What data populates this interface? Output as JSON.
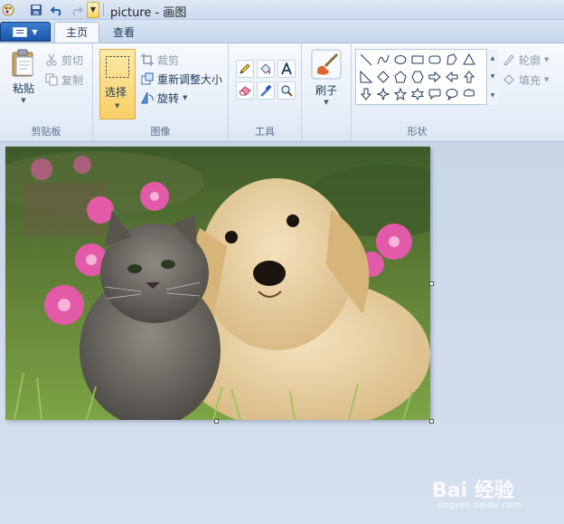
{
  "window": {
    "title": "picture - 画图"
  },
  "tabs": [
    {
      "label": "主页",
      "active": true
    },
    {
      "label": "查看",
      "active": false
    }
  ],
  "clipboard": {
    "group_label": "剪贴板",
    "paste_label": "粘贴",
    "cut_label": "剪切",
    "copy_label": "复制"
  },
  "image": {
    "group_label": "图像",
    "select_label": "选择",
    "crop_label": "裁剪",
    "resize_label": "重新调整大小",
    "rotate_label": "旋转"
  },
  "tools": {
    "group_label": "工具",
    "items": [
      "pencil-icon",
      "fill-icon",
      "text-icon",
      "eraser-icon",
      "color-picker-icon",
      "magnifier-icon"
    ]
  },
  "brushes": {
    "label": "刷子"
  },
  "shapes": {
    "group_label": "形状",
    "outline_label": "轮廓",
    "fill_label": "填充"
  },
  "canvas": {
    "description_icon": "kitten-and-puppy-photo"
  },
  "watermark": {
    "text": "Bai 经验",
    "sub": "jingyan.baidu.com"
  },
  "colors": {
    "accent": "#1a56a8",
    "selected": "#f9cf66",
    "ribbon": "#e6eef8"
  }
}
